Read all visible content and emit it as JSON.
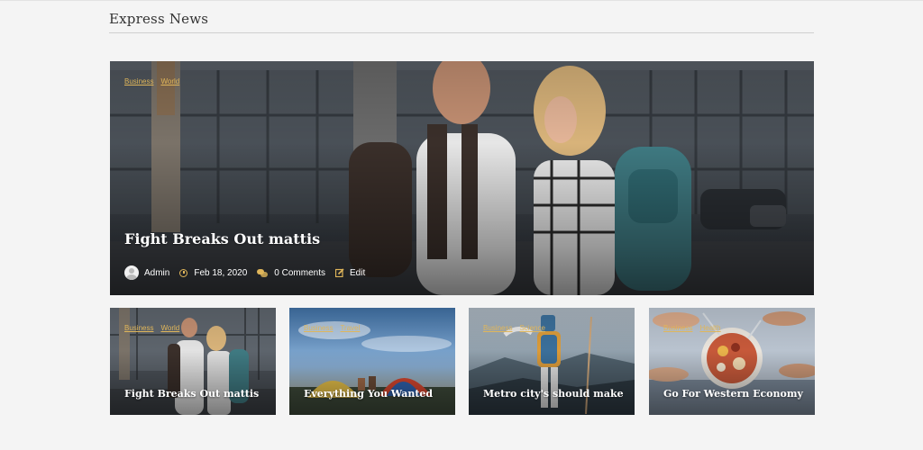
{
  "section": {
    "title": "Express News"
  },
  "featured": {
    "categories": [
      "Business",
      "World"
    ],
    "title": "Fight Breaks Out mattis",
    "meta": {
      "author": "Admin",
      "date": "Feb 18, 2020",
      "comments": "0 Comments",
      "edit": "Edit"
    }
  },
  "cards": [
    {
      "categories": [
        "Business",
        "World"
      ],
      "title": "Fight Breaks Out mattis"
    },
    {
      "categories": [
        "Business",
        "Travel"
      ],
      "title": "Everything You Wanted"
    },
    {
      "categories": [
        "Business",
        "Science"
      ],
      "title": "Metro city's should make"
    },
    {
      "categories": [
        "Business",
        "Health"
      ],
      "title": "Go For Western Economy"
    }
  ],
  "colors": {
    "accent": "#e0b65a",
    "background": "#f4f4f4",
    "title_text": "#333333"
  }
}
